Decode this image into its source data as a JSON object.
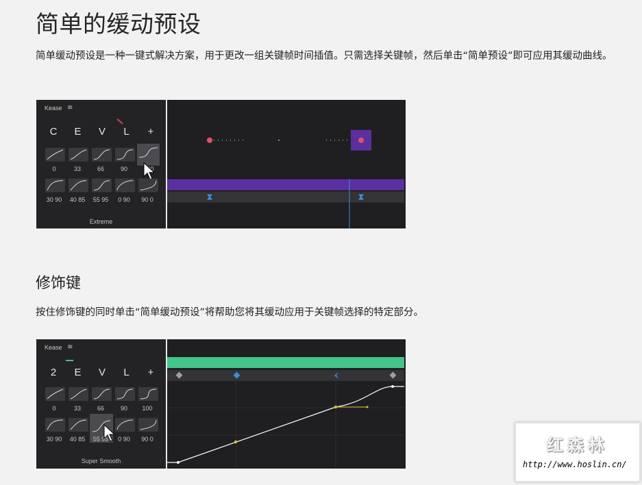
{
  "section1": {
    "title": "简单的缓动预设",
    "desc": "简单缓动预设是一种一键式解决方案，用于更改一组关键帧时间插值。只需选择关键帧，然后单击“简单预设”即可应用其缓动曲线。"
  },
  "section2": {
    "title": "修饰键",
    "desc": "按住修饰键的同时单击“简单缓动预设”将帮助您将其缓动应用于关键帧选择的特定部分。"
  },
  "screenshot1": {
    "panel_title": "Kease",
    "menu_icon": "hamburger-icon",
    "letters": [
      "C",
      "E",
      "V",
      "L",
      "+"
    ],
    "row1_labels": [
      "0",
      "33",
      "66",
      "90",
      "100"
    ],
    "row2_labels": [
      "30 90",
      "40 85",
      "55 95",
      "0 90",
      "90 0"
    ],
    "footer": "Extreme",
    "colors": {
      "layer_bar": "#5a2fa0",
      "keyframe": "#e0506a",
      "marker": "#3c8dde"
    }
  },
  "screenshot2": {
    "panel_title": "Kease",
    "menu_icon": "hamburger-icon",
    "letters": [
      "2",
      "E",
      "V",
      "L",
      "+"
    ],
    "row1_labels": [
      "0",
      "33",
      "66",
      "90",
      "100"
    ],
    "row2_labels": [
      "30 90",
      "40 85",
      "55 95",
      "0 90",
      "90 0"
    ],
    "footer": "Super Smooth",
    "colors": {
      "layer_bar": "#41c58a",
      "curve": "#ffffff",
      "handle": "#e4c22e"
    }
  },
  "watermark": {
    "title": "红森林",
    "url": "http://www.hoslin.cn/"
  }
}
